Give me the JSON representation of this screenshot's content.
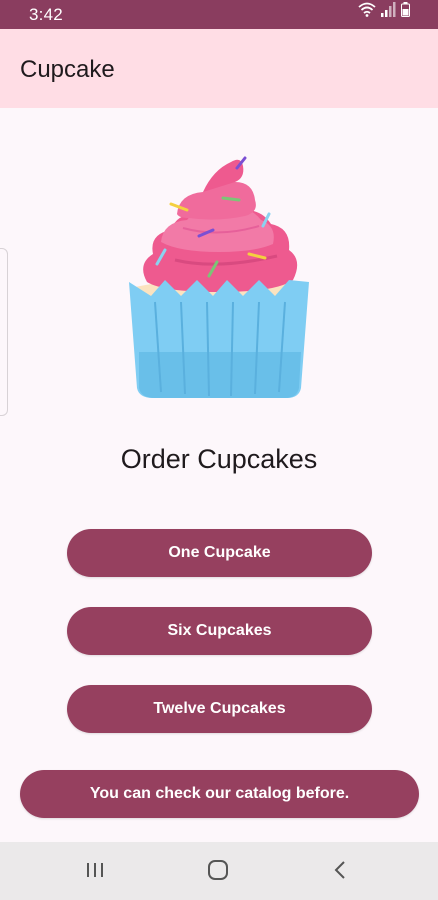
{
  "status_bar": {
    "time": "3:42",
    "icons": [
      "wifi-icon",
      "signal-icon",
      "battery-icon"
    ]
  },
  "app_bar": {
    "title": "Cupcake"
  },
  "main": {
    "image": "cupcake-illustration",
    "heading": "Order Cupcakes",
    "buttons": [
      {
        "label": "One Cupcake"
      },
      {
        "label": "Six Cupcakes"
      },
      {
        "label": "Twelve Cupcakes"
      }
    ],
    "catalog_button": {
      "label": "You can check our catalog before."
    }
  },
  "nav_bar": {
    "icons": [
      "recents-icon",
      "home-icon",
      "back-icon"
    ]
  },
  "colors": {
    "status_bar": "#8a3d5f",
    "app_bar": "#ffdde5",
    "background": "#fdf7fb",
    "button": "#96405f",
    "nav_bar": "#ebe9ea"
  }
}
